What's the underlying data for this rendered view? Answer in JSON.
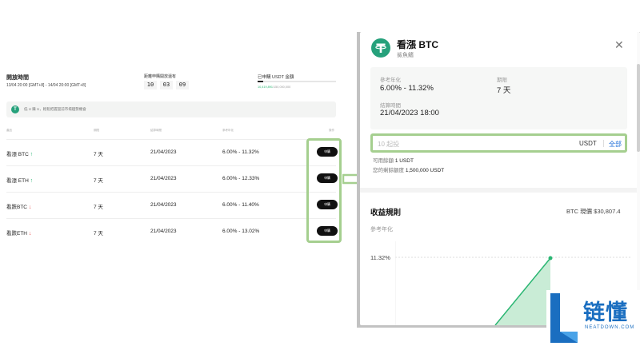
{
  "left": {
    "open_time_label": "開放時間",
    "open_time_range": "13/04 20:00 [GMT+8] - 14/04 20:00 [GMT+8]",
    "countdown_label": "距離申購開放還有",
    "countdown": [
      "10",
      "03",
      "09"
    ],
    "bought_label": "已申購 USDT 金額",
    "bought_value": "10,419,891",
    "bought_total": "/150,000,000",
    "bought_progress": 0.07,
    "tip_icon": "usdt-icon",
    "tip_text": "低 U 賺 U，輕鬆把握當前市場趨勢機會",
    "headers": {
      "product": "產品",
      "term": "期限",
      "settle": "結算時間",
      "rate": "參考年化",
      "action": "操作"
    },
    "rows": [
      {
        "name": "看漲 BTC",
        "direction": "up",
        "term": "7 天",
        "settle": "21/04/2023",
        "rate": "6.00% - 11.32%",
        "button": "申購"
      },
      {
        "name": "看漲 ETH",
        "direction": "up",
        "term": "7 天",
        "settle": "21/04/2023",
        "rate": "6.00% - 12.33%",
        "button": "申購"
      },
      {
        "name": "看跌BTC",
        "direction": "down",
        "term": "7 天",
        "settle": "21/04/2023",
        "rate": "6.00% - 11.40%",
        "button": "申購"
      },
      {
        "name": "看跌ETH",
        "direction": "down",
        "term": "7 天",
        "settle": "21/04/2023",
        "rate": "6.00% - 13.02%",
        "button": "申購"
      }
    ]
  },
  "modal": {
    "logo_icon": "tether-icon",
    "title": "看漲 BTC",
    "subtitle": "鯊魚鰭",
    "close_icon": "close-icon",
    "ref_rate_label": "參考年化",
    "ref_rate_value": "6.00% - 11.32%",
    "term_label": "期限",
    "term_value": "7 天",
    "settle_label": "結算時間",
    "settle_value": "21/04/2023 18:00",
    "amount_placeholder": "10 起投",
    "amount_unit": "USDT",
    "amount_all": "全部",
    "available_label": "可用餘額",
    "available_value": "1 USDT",
    "limit_label": "您的剩餘額度",
    "limit_value": "1,500,000 USDT",
    "rules_title": "收益規則",
    "btc_price": "BTC 現價 $30,807.4",
    "chart_ref_label": "參考年化",
    "chart_y_tick": "11.32%"
  },
  "watermark": {
    "cn": "链懂",
    "en": "NEATDOWN.COM"
  },
  "colors": {
    "accent_green": "#2bb673",
    "tether_green": "#26a17b",
    "highlight": "#a5cf8f",
    "down_red": "#e84b4b",
    "link_blue": "#1e6fd9",
    "watermark_blue": "#1a6ec0"
  }
}
